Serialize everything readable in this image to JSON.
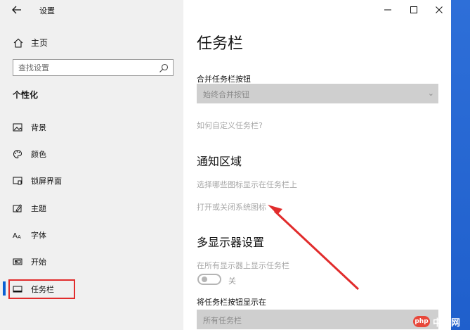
{
  "app": {
    "title": "设置"
  },
  "sidebar": {
    "home_label": "主页",
    "search_placeholder": "查找设置",
    "section_title": "个性化",
    "items": [
      {
        "label": "背景",
        "icon": "image-icon"
      },
      {
        "label": "颜色",
        "icon": "palette-icon"
      },
      {
        "label": "锁屏界面",
        "icon": "lock-screen-icon"
      },
      {
        "label": "主题",
        "icon": "theme-icon"
      },
      {
        "label": "字体",
        "icon": "font-icon"
      },
      {
        "label": "开始",
        "icon": "start-icon"
      },
      {
        "label": "任务栏",
        "icon": "taskbar-icon",
        "active": true
      }
    ]
  },
  "main": {
    "title": "任务栏",
    "combine_label": "合并任务栏按钮",
    "combine_value": "始终合并按钮",
    "customize_link": "如何自定义任务栏?",
    "notification_title": "通知区域",
    "select_icons_link": "选择哪些图标显示在任务栏上",
    "system_icons_link": "打开或关闭系统图标",
    "multi_display_title": "多显示器设置",
    "show_all_label": "在所有显示器上显示任务栏",
    "show_all_toggle_text": "关",
    "show_buttons_label": "将任务栏按钮显示在",
    "show_buttons_value": "所有任务栏"
  },
  "watermark": {
    "badge": "php",
    "text": "中文网"
  },
  "colors": {
    "accent": "#0a5fd4",
    "highlight": "#e12c2c",
    "sidebar_bg": "#f0f0f0"
  }
}
